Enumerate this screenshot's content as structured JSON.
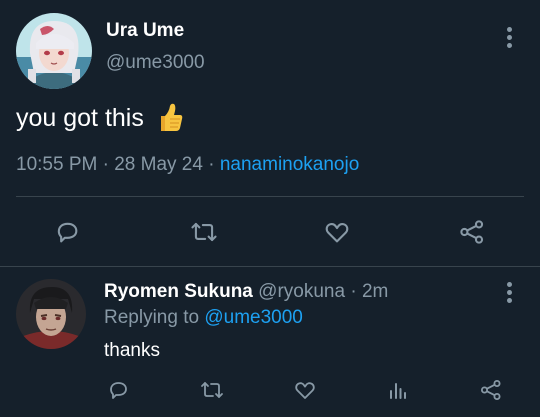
{
  "tweet": {
    "author_name": "Ura Ume",
    "author_handle": "@ume3000",
    "text": "you got this",
    "emoji_icon": "thumbs-up-emoji",
    "time": "10:55 PM",
    "date": "28 May 24",
    "source": "nanaminokanojo",
    "separator": "·"
  },
  "reply": {
    "author_name": "Ryomen Sukuna",
    "author_handle": "@ryokuna",
    "time_ago": "2m",
    "separator": "·",
    "replying_prefix": "Replying to",
    "replying_handle": "@ume3000",
    "text": "thanks"
  },
  "icons": {
    "main_actions": [
      "comment-icon",
      "retweet-icon",
      "like-icon",
      "share-icon"
    ],
    "reply_actions": [
      "comment-icon",
      "retweet-icon",
      "like-icon",
      "analytics-icon",
      "share-icon"
    ]
  },
  "colors": {
    "background": "#15202b",
    "text": "#ffffff",
    "secondary_text": "#8899a6",
    "link": "#1da1f2",
    "icon": "#8899a6",
    "divider": "#38444d"
  }
}
